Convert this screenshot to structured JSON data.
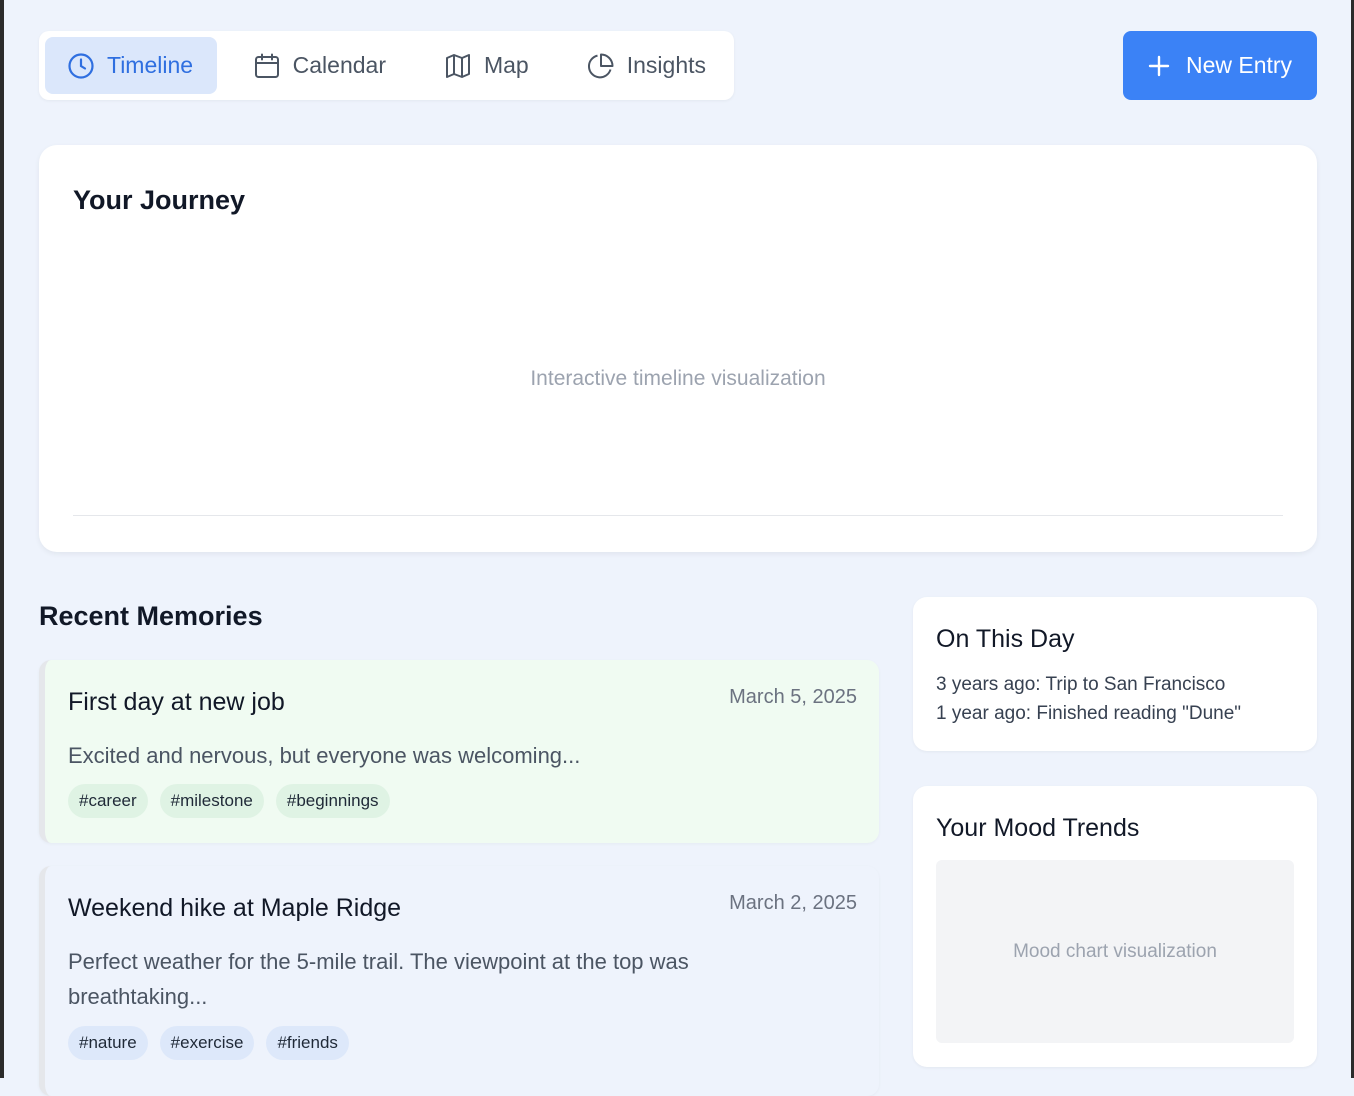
{
  "nav": {
    "tabs": [
      {
        "label": "Timeline",
        "icon": "clock-icon",
        "active": true
      },
      {
        "label": "Calendar",
        "icon": "calendar-icon",
        "active": false
      },
      {
        "label": "Map",
        "icon": "map-icon",
        "active": false
      },
      {
        "label": "Insights",
        "icon": "pie-chart-icon",
        "active": false
      }
    ],
    "new_entry_label": "New Entry"
  },
  "journey": {
    "title": "Your Journey",
    "placeholder": "Interactive timeline visualization"
  },
  "recent": {
    "title": "Recent Memories",
    "items": [
      {
        "title": "First day at new job",
        "date": "March 5, 2025",
        "text": "Excited and nervous, but everyone was welcoming...",
        "tags": [
          "#career",
          "#milestone",
          "#beginnings"
        ]
      },
      {
        "title": "Weekend hike at Maple Ridge",
        "date": "March 2, 2025",
        "text": "Perfect weather for the 5-mile trail. The viewpoint at the top was breathtaking...",
        "tags": [
          "#nature",
          "#exercise",
          "#friends"
        ]
      }
    ]
  },
  "on_this_day": {
    "title": "On This Day",
    "lines": [
      "3 years ago: Trip to San Francisco",
      "1 year ago: Finished reading \"Dune\""
    ]
  },
  "mood": {
    "title": "Your Mood Trends",
    "placeholder": "Mood chart visualization"
  },
  "colors": {
    "accent": "#3b82f6",
    "active_tab_bg": "#dbe7fb",
    "page_bg": "#eef3fc"
  }
}
